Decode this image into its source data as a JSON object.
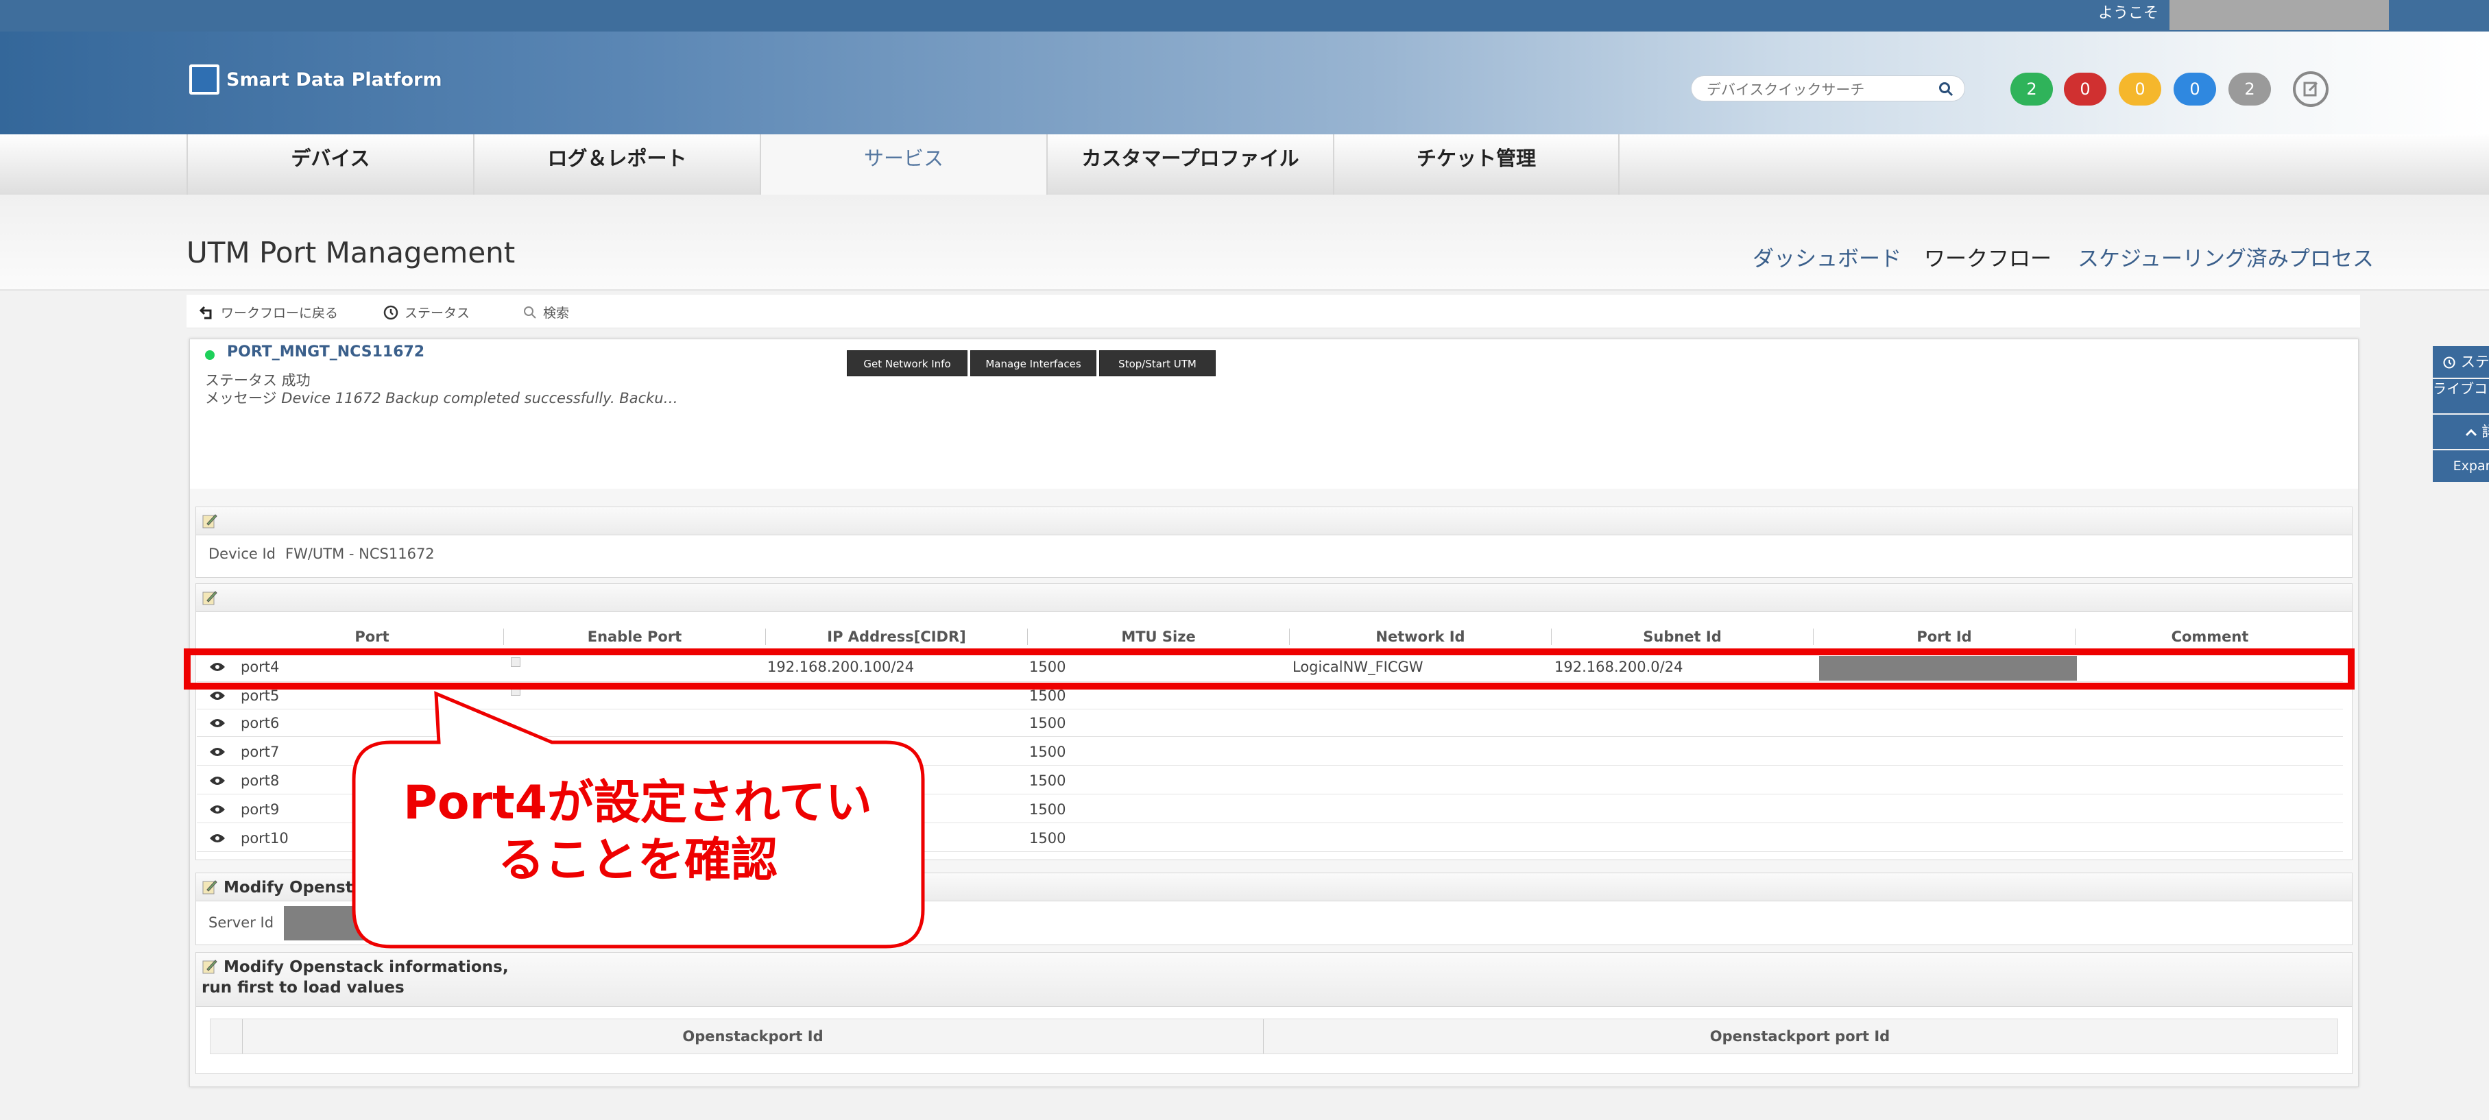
{
  "header": {
    "welcome": "ようこそ",
    "brand": "Smart Data Platform",
    "search_placeholder": "デバイスクイックサーチ",
    "badges": [
      {
        "value": "2",
        "color": "#2fb35a"
      },
      {
        "value": "0",
        "color": "#d03030"
      },
      {
        "value": "0",
        "color": "#f5b72c"
      },
      {
        "value": "0",
        "color": "#2f88e0"
      },
      {
        "value": "2",
        "color": "#9a9a9a"
      }
    ]
  },
  "nav": {
    "items": [
      "デバイス",
      "ログ＆レポート",
      "サービス",
      "カスタマープロファイル",
      "チケット管理"
    ],
    "active": "サービス"
  },
  "page": {
    "title": "UTM Port Management",
    "links": [
      "ダッシュボード",
      "ワークフロー",
      "スケジューリング済みプロセス"
    ]
  },
  "toolbar": {
    "back": "ワークフローに戻る",
    "status": "ステータス",
    "search": "検索"
  },
  "workflow": {
    "name": "PORT_MNGT_NCS11672",
    "status_line": "ステータス 成功",
    "message_label": "メッセージ",
    "message_text": "Device 11672 Backup completed successfully. Backu…",
    "actions": [
      "Get Network Info",
      "Manage Interfaces",
      "Stop/Start UTM"
    ],
    "side_buttons": {
      "status": "ステータス",
      "live_console": "ライブコンソール",
      "details": "詳細",
      "expand_all": "Expand All"
    }
  },
  "device_section": {
    "label": "Device Id",
    "value": "FW/UTM - NCS11672"
  },
  "port_table": {
    "columns": [
      "Port",
      "Enable Port",
      "IP Address[CIDR]",
      "MTU Size",
      "Network Id",
      "Subnet Id",
      "Port Id",
      "Comment"
    ],
    "rows": [
      {
        "port": "port4",
        "ip": "192.168.200.100/24",
        "mtu": "1500",
        "network": "LogicalNW_FICGW",
        "subnet": "192.168.200.0/24"
      },
      {
        "port": "port5",
        "ip": "",
        "mtu": "1500",
        "network": "",
        "subnet": ""
      },
      {
        "port": "port6",
        "ip": "",
        "mtu": "1500",
        "network": "",
        "subnet": ""
      },
      {
        "port": "port7",
        "ip": "",
        "mtu": "1500",
        "network": "",
        "subnet": ""
      },
      {
        "port": "port8",
        "ip": "",
        "mtu": "1500",
        "network": "",
        "subnet": ""
      },
      {
        "port": "port9",
        "ip": "",
        "mtu": "1500",
        "network": "",
        "subnet": ""
      },
      {
        "port": "port10",
        "ip": "",
        "mtu": "1500",
        "network": "",
        "subnet": ""
      }
    ]
  },
  "modify_section_1": {
    "title": "Modify Openstac",
    "server_label": "Server Id"
  },
  "modify_section_2": {
    "title_line1": "Modify Openstack informations,",
    "title_line2": "run first to load values",
    "columns": [
      "Openstackport Id",
      "Openstackport port Id"
    ]
  },
  "annotation": {
    "line1": "Port4が設定されてい",
    "line2": "ることを確認",
    "color": "#ee0000"
  }
}
